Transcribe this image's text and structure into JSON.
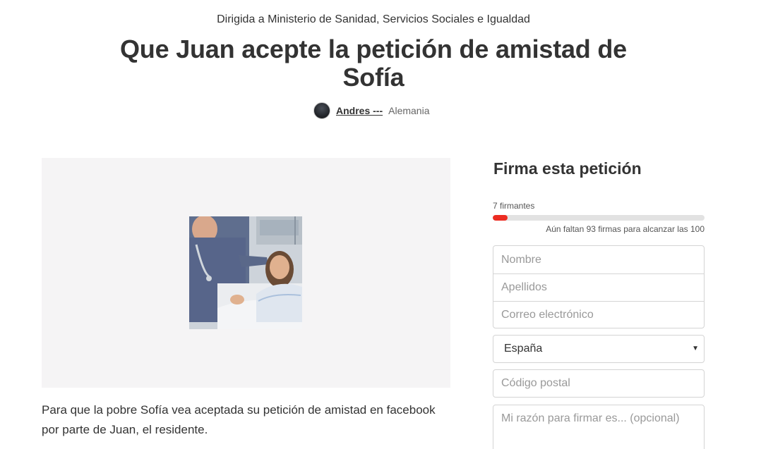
{
  "petition": {
    "targeting": "Dirigida a Ministerio de Sanidad, Servicios Sociales e Igualdad",
    "title": "Que Juan acepte la petición de amistad de Sofía",
    "author_name": "Andres ---",
    "author_location": "Alemania",
    "description": "Para que la pobre Sofía vea aceptada su petición de amistad en facebook por parte de Juan, el residente."
  },
  "sign_form": {
    "title": "Firma esta petición",
    "signature_count": "7 firmantes",
    "signatures_goal_progress": 0.07,
    "remaining_text": "Aún faltan 93 firmas para alcanzar las 100",
    "first_name_placeholder": "Nombre",
    "last_name_placeholder": "Apellidos",
    "email_placeholder": "Correo electrónico",
    "country_selected": "España",
    "postal_code_placeholder": "Código postal",
    "reason_placeholder": "Mi razón para firmar es... (opcional)"
  },
  "colors": {
    "progress_fill": "#ec2c22",
    "progress_track": "#e2e2e2",
    "media_background": "#f5f4f5"
  }
}
